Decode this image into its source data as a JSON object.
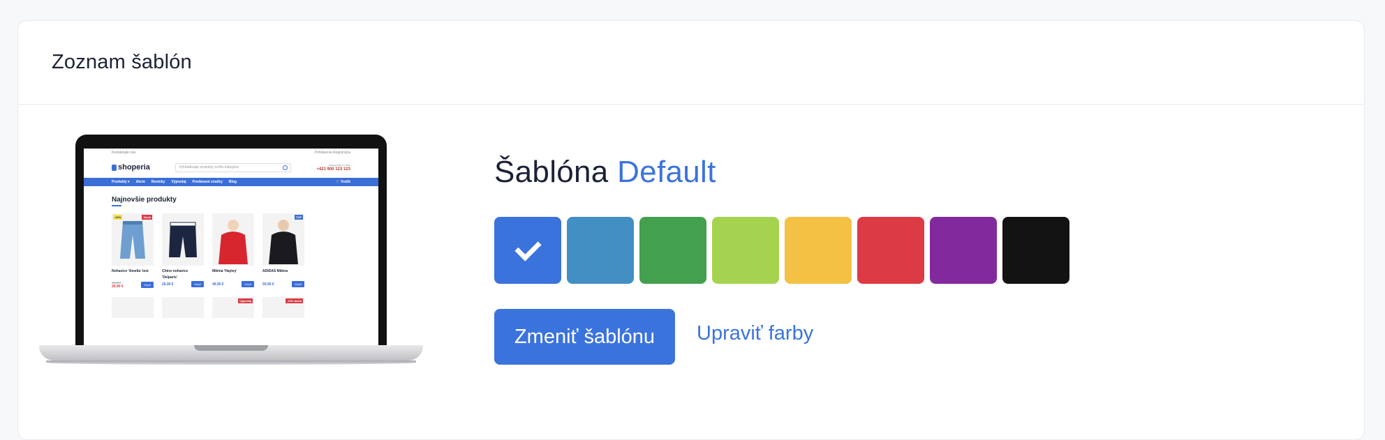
{
  "card": {
    "title": "Zoznam šablón"
  },
  "template": {
    "label": "Šablóna",
    "name": "Default",
    "change_button": "Zmeniť šablónu",
    "edit_colors_link": "Upraviť farby"
  },
  "colors": [
    {
      "name": "blue",
      "hex": "#3b73dd",
      "selected": true
    },
    {
      "name": "steel-blue",
      "hex": "#428fc3",
      "selected": false
    },
    {
      "name": "green",
      "hex": "#43a04f",
      "selected": false
    },
    {
      "name": "lime",
      "hex": "#a6d34f",
      "selected": false
    },
    {
      "name": "yellow",
      "hex": "#f4c144",
      "selected": false
    },
    {
      "name": "red",
      "hex": "#dc3a45",
      "selected": false
    },
    {
      "name": "purple",
      "hex": "#83299e",
      "selected": false
    },
    {
      "name": "black",
      "hex": "#131313",
      "selected": false
    }
  ],
  "preview": {
    "top_left": "Kontaktujte nás",
    "top_right": "Prihlásenie   Registrácia",
    "logo": "shoperia",
    "search_placeholder": "Vyhľadávajte produkty zvoľte kategóriu",
    "phone_label": "Nakupujte s nami",
    "phone": "+421 900 123 123",
    "nav": [
      "Produkty ▾",
      "Akcie",
      "Novinky",
      "Výpredaj",
      "Predávané značky",
      "Blog"
    ],
    "cart": "Košík",
    "heading": "Najnovšie produkty",
    "products": [
      {
        "name": "Nohavice 'Amelia' test",
        "old_price": "29,90 €",
        "price": "26,90 €",
        "badge_left": "-10%",
        "badge_right": "Akcia",
        "sale": true
      },
      {
        "name": "Chino nohavice 'Delparis'",
        "old_price": "",
        "price": "26,90 €",
        "badge_left": "",
        "badge_right": "",
        "sale": false
      },
      {
        "name": "Mikina 'Hayley'",
        "old_price": "",
        "price": "49,90 €",
        "badge_left": "",
        "badge_right": "",
        "sale": false
      },
      {
        "name": "ADIDAS Mikina",
        "old_price": "",
        "price": "59,90 €",
        "badge_left": "",
        "badge_right": "TOP",
        "sale": false
      }
    ],
    "buy_label": "Kúpiť",
    "row2_badges": [
      "",
      "",
      "Výpredaj",
      "-10% Akcia"
    ]
  }
}
